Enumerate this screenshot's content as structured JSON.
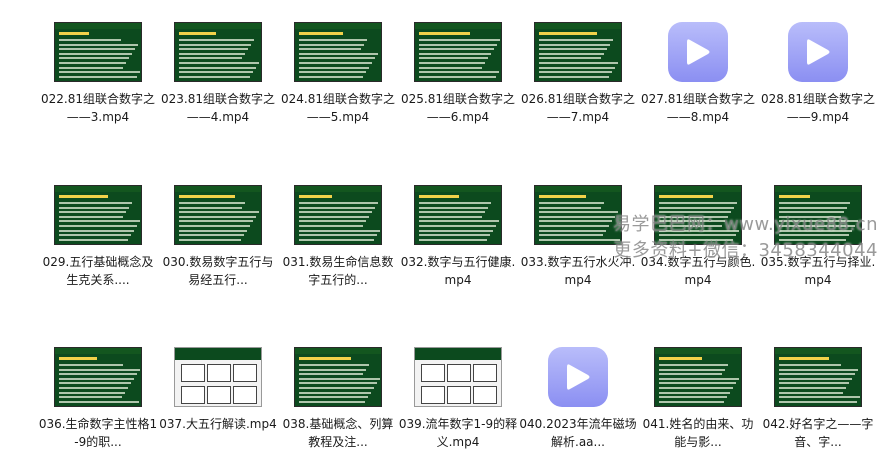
{
  "files": [
    {
      "label": "022.81组联合数字之——3.mp4",
      "thumb": "video"
    },
    {
      "label": "023.81组联合数字之——4.mp4",
      "thumb": "video"
    },
    {
      "label": "024.81组联合数字之——5.mp4",
      "thumb": "video"
    },
    {
      "label": "025.81组联合数字之——6.mp4",
      "thumb": "video"
    },
    {
      "label": "026.81组联合数字之——7.mp4",
      "thumb": "video"
    },
    {
      "label": "027.81组联合数字之——8.mp4",
      "thumb": "play"
    },
    {
      "label": "028.81组联合数字之——9.mp4",
      "thumb": "play"
    },
    {
      "label": "029.五行基础概念及生克关系....",
      "thumb": "video"
    },
    {
      "label": "030.数易数字五行与易经五行...",
      "thumb": "video"
    },
    {
      "label": "031.数易生命信息数字五行的...",
      "thumb": "video"
    },
    {
      "label": "032.数字与五行健康.mp4",
      "thumb": "video"
    },
    {
      "label": "033.数字五行水火冲.mp4",
      "thumb": "video"
    },
    {
      "label": "034.数字五行与颜色.mp4",
      "thumb": "video"
    },
    {
      "label": "035.数字五行与择业.mp4",
      "thumb": "video"
    },
    {
      "label": "036.生命数字主性格1-9的职...",
      "thumb": "video"
    },
    {
      "label": "037.大五行解读.mp4",
      "thumb": "diagram"
    },
    {
      "label": "038.基础概念、列算教程及注...",
      "thumb": "video"
    },
    {
      "label": "039.流年数字1-9的释义.mp4",
      "thumb": "diagram"
    },
    {
      "label": "040.2023年流年磁场解析.aa...",
      "thumb": "play"
    },
    {
      "label": "041.姓名的由来、功能与影...",
      "thumb": "video"
    },
    {
      "label": "042.好名字之——字音、字...",
      "thumb": "video"
    }
  ],
  "watermark": {
    "line1": "易学巴巴网：www.yixue88.cn",
    "line2": "更多资料+微信：3458344044"
  },
  "colors": {
    "thumb_bg": "#0c4a1e",
    "play_tile": "#8b8ff2"
  }
}
